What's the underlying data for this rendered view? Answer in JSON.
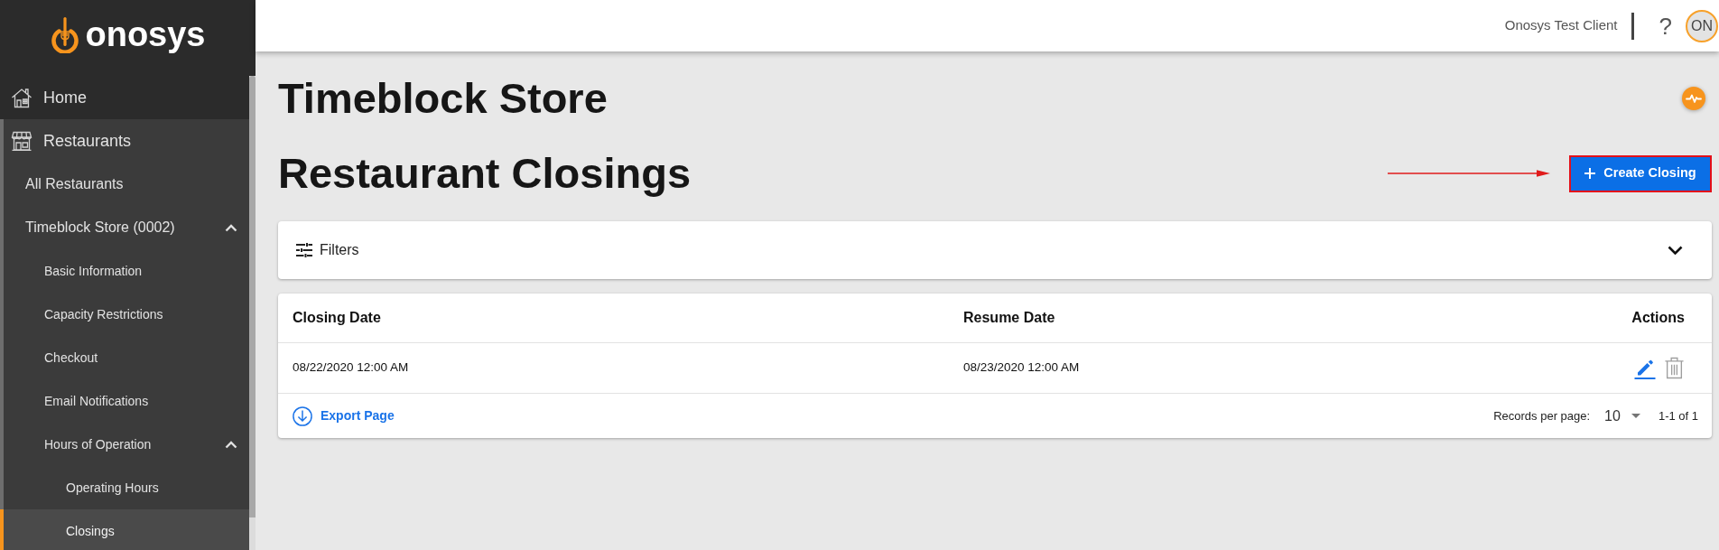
{
  "header": {
    "client_name": "Onosys Test Client",
    "help_label": "?",
    "avatar_initials": "ON"
  },
  "sidebar": {
    "logo_text": "onosys",
    "items": [
      {
        "kind": "section",
        "label": "Home",
        "selected": false
      },
      {
        "kind": "section",
        "label": "Restaurants",
        "selected": false,
        "expanded": true,
        "children": [
          {
            "kind": "link",
            "label": "All Restaurants",
            "selected": false
          },
          {
            "kind": "group",
            "label": "Timeblock Store (0002)",
            "selected": false,
            "expanded": true,
            "children": [
              {
                "kind": "link",
                "label": "Basic Information",
                "selected": false
              },
              {
                "kind": "link",
                "label": "Capacity Restrictions",
                "selected": false
              },
              {
                "kind": "link",
                "label": "Checkout",
                "selected": false
              },
              {
                "kind": "link",
                "label": "Email Notifications",
                "selected": false
              },
              {
                "kind": "group",
                "label": "Hours of Operation",
                "selected": false,
                "expanded": true,
                "children": [
                  {
                    "kind": "link",
                    "label": "Operating Hours",
                    "selected": false
                  },
                  {
                    "kind": "link",
                    "label": "Closings",
                    "selected": true
                  }
                ]
              }
            ]
          }
        ]
      }
    ]
  },
  "page": {
    "store_title": "Timeblock Store",
    "title": "Restaurant Closings",
    "create_button": {
      "label": "Create Closing",
      "outlined": true,
      "callout_arrow": true
    }
  },
  "filters": {
    "label": "Filters",
    "expanded": false
  },
  "table": {
    "columns": [
      "Closing Date",
      "Resume Date",
      "Actions"
    ],
    "rows": [
      {
        "cells": [
          "08/22/2020 12:00 AM",
          "08/23/2020 12:00 AM"
        ]
      }
    ]
  },
  "footer": {
    "export_label": "Export Page",
    "records_label": "Records per page:",
    "page_size": "10",
    "range": "1-1 of 1"
  }
}
